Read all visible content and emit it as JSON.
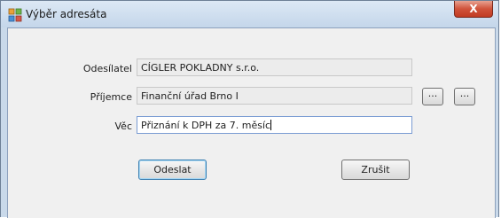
{
  "window": {
    "title": "Výběr adresáta",
    "close_label": "X"
  },
  "form": {
    "sender_label": "Odesílatel",
    "sender_value": "CÍGLER POKLADNY s.r.o.",
    "recipient_label": "Příjemce",
    "recipient_value": "Finanční úřad Brno I",
    "browse_button_1": "...",
    "browse_button_2": "...",
    "subject_label": "Věc",
    "subject_value": "Přiznání k DPH za 7. měsíc"
  },
  "buttons": {
    "send": "Odeslat",
    "cancel": "Zrušit"
  }
}
